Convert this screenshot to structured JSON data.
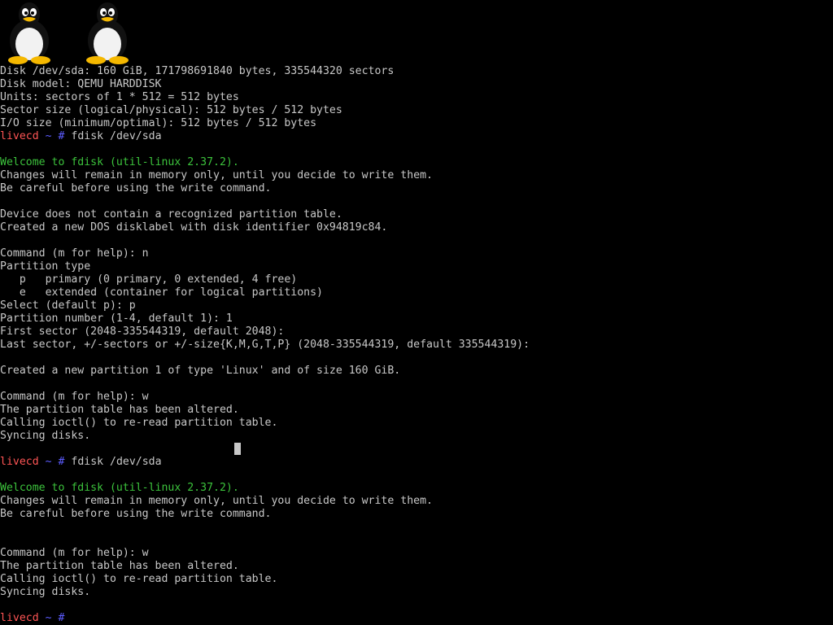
{
  "logos": [
    "tux-icon",
    "tux-icon"
  ],
  "prompt": {
    "host": "livecd",
    "dir": "~",
    "symbol": "#"
  },
  "lines": [
    {
      "kind": "text",
      "text": "Disk /dev/sda: 160 GiB, 171798691840 bytes, 335544320 sectors"
    },
    {
      "kind": "text",
      "text": "Disk model: QEMU HARDDISK"
    },
    {
      "kind": "text",
      "text": "Units: sectors of 1 * 512 = 512 bytes"
    },
    {
      "kind": "text",
      "text": "Sector size (logical/physical): 512 bytes / 512 bytes"
    },
    {
      "kind": "text",
      "text": "I/O size (minimum/optimal): 512 bytes / 512 bytes"
    },
    {
      "kind": "prompt",
      "text": "fdisk /dev/sda"
    },
    {
      "kind": "blank",
      "text": ""
    },
    {
      "kind": "green",
      "text": "Welcome to fdisk (util-linux 2.37.2)."
    },
    {
      "kind": "text",
      "text": "Changes will remain in memory only, until you decide to write them."
    },
    {
      "kind": "text",
      "text": "Be careful before using the write command."
    },
    {
      "kind": "blank",
      "text": ""
    },
    {
      "kind": "text",
      "text": "Device does not contain a recognized partition table."
    },
    {
      "kind": "text",
      "text": "Created a new DOS disklabel with disk identifier 0x94819c84."
    },
    {
      "kind": "blank",
      "text": ""
    },
    {
      "kind": "text",
      "text": "Command (m for help): n"
    },
    {
      "kind": "text",
      "text": "Partition type"
    },
    {
      "kind": "text",
      "text": "   p   primary (0 primary, 0 extended, 4 free)"
    },
    {
      "kind": "text",
      "text": "   e   extended (container for logical partitions)"
    },
    {
      "kind": "text",
      "text": "Select (default p): p"
    },
    {
      "kind": "text",
      "text": "Partition number (1-4, default 1): 1"
    },
    {
      "kind": "text",
      "text": "First sector (2048-335544319, default 2048):"
    },
    {
      "kind": "text",
      "text": "Last sector, +/-sectors or +/-size{K,M,G,T,P} (2048-335544319, default 335544319):"
    },
    {
      "kind": "blank",
      "text": ""
    },
    {
      "kind": "text",
      "text": "Created a new partition 1 of type 'Linux' and of size 160 GiB."
    },
    {
      "kind": "blank",
      "text": ""
    },
    {
      "kind": "text",
      "text": "Command (m for help): w"
    },
    {
      "kind": "text",
      "text": "The partition table has been altered."
    },
    {
      "kind": "text",
      "text": "Calling ioctl() to re-read partition table."
    },
    {
      "kind": "text",
      "text": "Syncing disks."
    },
    {
      "kind": "blank",
      "text": ""
    },
    {
      "kind": "prompt",
      "text": "fdisk /dev/sda"
    },
    {
      "kind": "blank",
      "text": ""
    },
    {
      "kind": "green",
      "text": "Welcome to fdisk (util-linux 2.37.2)."
    },
    {
      "kind": "text",
      "text": "Changes will remain in memory only, until you decide to write them."
    },
    {
      "kind": "text",
      "text": "Be careful before using the write command."
    },
    {
      "kind": "blank",
      "text": ""
    },
    {
      "kind": "blank",
      "text": ""
    },
    {
      "kind": "text",
      "text": "Command (m for help): w"
    },
    {
      "kind": "text",
      "text": "The partition table has been altered."
    },
    {
      "kind": "text",
      "text": "Calling ioctl() to re-read partition table."
    },
    {
      "kind": "text",
      "text": "Syncing disks."
    },
    {
      "kind": "blank",
      "text": ""
    },
    {
      "kind": "prompt",
      "text": ""
    }
  ]
}
